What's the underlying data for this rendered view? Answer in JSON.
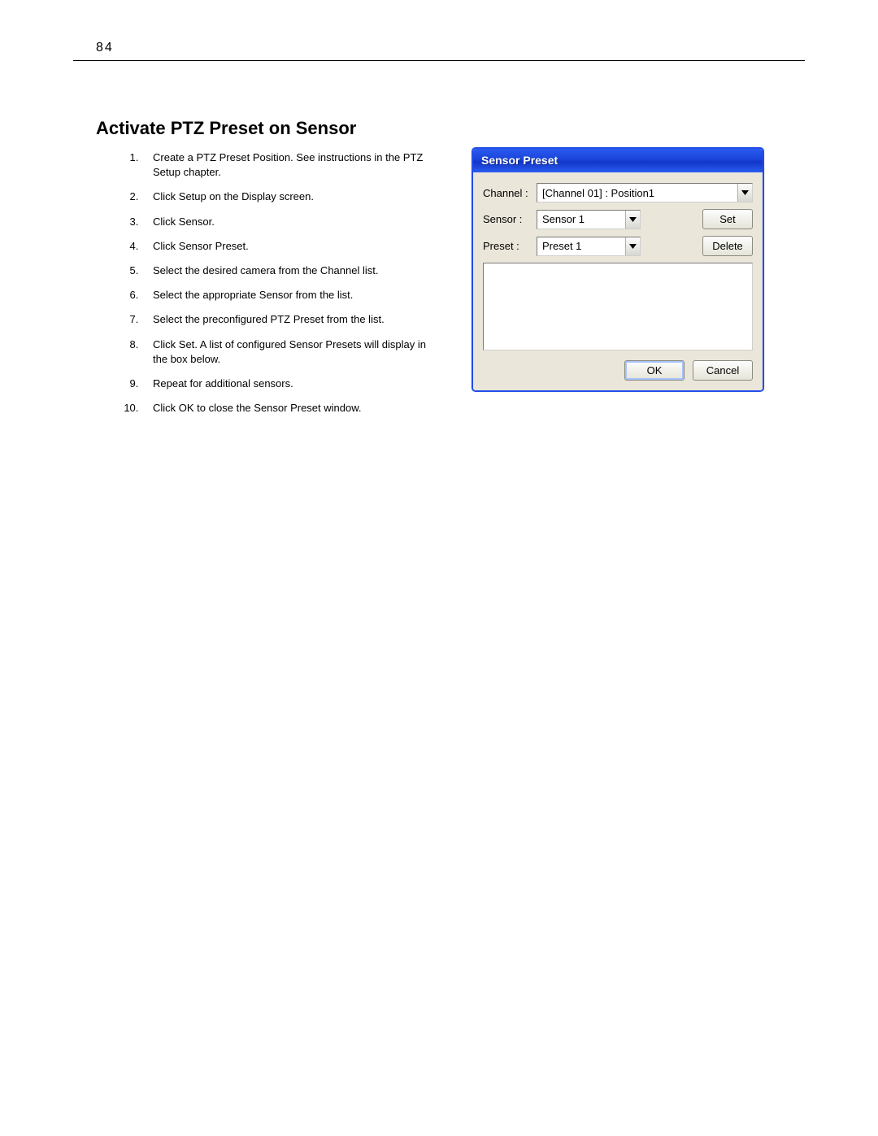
{
  "page_number": "84",
  "heading": "Activate PTZ Preset on Sensor",
  "steps": [
    "Create a PTZ Preset Position. See instructions in the PTZ Setup chapter.",
    "Click Setup on the Display screen.",
    "Click Sensor.",
    "Click Sensor Preset.",
    "Select the desired camera from the Channel list.",
    "Select the appropriate Sensor from the list.",
    "Select the preconfigured PTZ Preset from the list.",
    "Click Set. A list of configured Sensor Presets will display in the box below.",
    "Repeat for additional sensors.",
    "Click OK to close the Sensor Preset window."
  ],
  "dialog": {
    "title": "Sensor Preset",
    "labels": {
      "channel": "Channel :",
      "sensor": "Sensor :",
      "preset": "Preset :"
    },
    "values": {
      "channel": "[Channel 01] : Position1",
      "sensor": "Sensor 1",
      "preset": "Preset 1"
    },
    "buttons": {
      "set": "Set",
      "delete": "Delete",
      "ok": "OK",
      "cancel": "Cancel"
    }
  }
}
